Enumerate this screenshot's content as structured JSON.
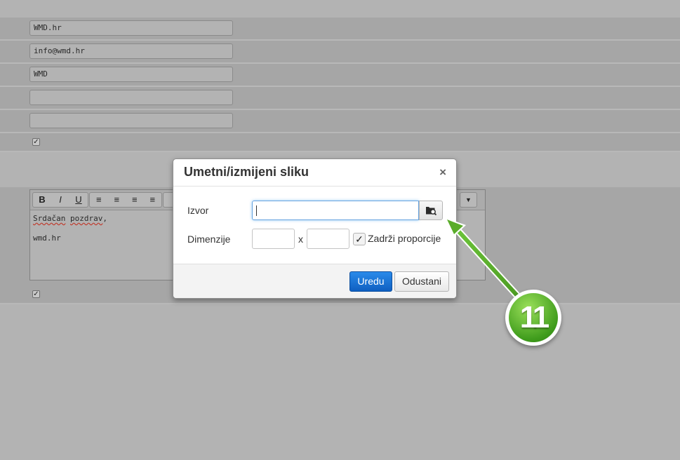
{
  "form": {
    "fields": [
      "WMD.hr",
      "info@wmd.hr",
      "WMD",
      "",
      ""
    ]
  },
  "editor": {
    "toolbar": [
      {
        "icon": "bold-icon",
        "glyph": "B"
      },
      {
        "icon": "italic-icon",
        "glyph": "I"
      },
      {
        "icon": "underline-icon",
        "glyph": "U"
      },
      {
        "icon": "align-left-icon",
        "glyph": "≡"
      },
      {
        "icon": "align-center-icon",
        "glyph": "≡"
      },
      {
        "icon": "align-right-icon",
        "glyph": "≡"
      },
      {
        "icon": "align-justify-icon",
        "glyph": "≡"
      }
    ],
    "text_line1_a": "Srdačan",
    "text_line1_sp": " ",
    "text_line1_b": "pozdrav",
    "text_line1_c": ",",
    "text_line2": "wmd.hr"
  },
  "modal": {
    "title": "Umetni/izmijeni sliku",
    "close": "×",
    "source_label": "Izvor",
    "source_value": "",
    "dimensions_label": "Dimenzije",
    "dim_separator": "x",
    "keep_proportions_label": "Zadrži proporcije",
    "keep_proportions_checked": true,
    "ok_label": "Uredu",
    "cancel_label": "Odustani"
  },
  "annotation": {
    "step_number": "11",
    "color": "#5aac2a"
  }
}
